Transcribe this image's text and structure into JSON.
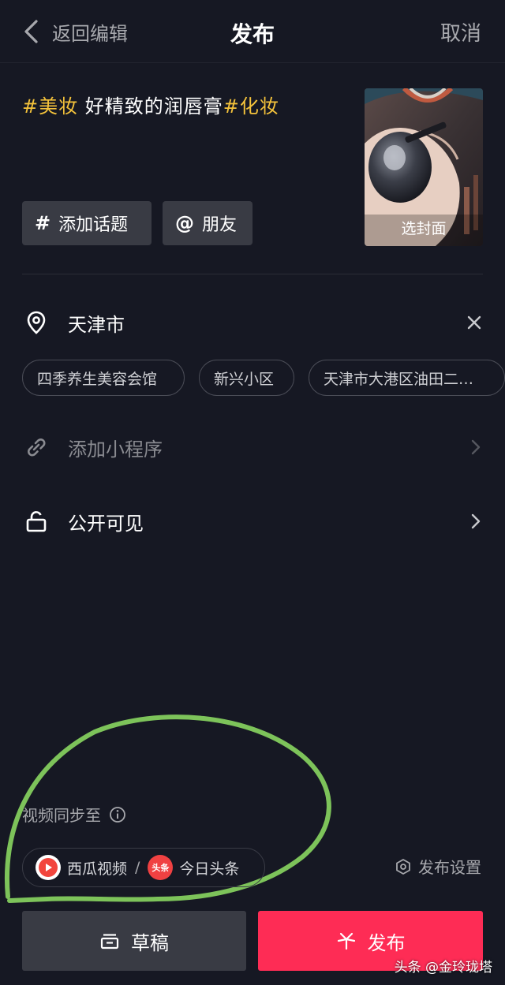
{
  "header": {
    "back_label": "返回编辑",
    "title": "发布",
    "cancel_label": "取消"
  },
  "caption": {
    "tag1": "#美妆",
    "text": " 好精致的润唇膏",
    "tag2": "#化妆"
  },
  "cover": {
    "label": "选封面"
  },
  "chips": {
    "topic": {
      "symbol": "#",
      "label": "添加话题"
    },
    "friends": {
      "symbol": "@",
      "label": "朋友"
    }
  },
  "location": {
    "city": "天津市",
    "suggestions": [
      "四季养生美容会馆",
      "新兴小区",
      "天津市大港区油田二…"
    ]
  },
  "mini_program": {
    "label": "添加小程序"
  },
  "visibility": {
    "label": "公开可见"
  },
  "sync": {
    "label": "视频同步至",
    "xigua_label": "西瓜视频",
    "separator": "/",
    "toutiao_badge": "头条",
    "toutiao_label": "今日头条",
    "settings_label": "发布设置"
  },
  "actions": {
    "draft_label": "草稿",
    "publish_label": "发布"
  },
  "watermark": "头条 @金玲珑塔",
  "colors": {
    "background": "#161823",
    "accent": "#fe2c55",
    "tag": "#f5c33b",
    "annotation": "#7dc35a"
  }
}
